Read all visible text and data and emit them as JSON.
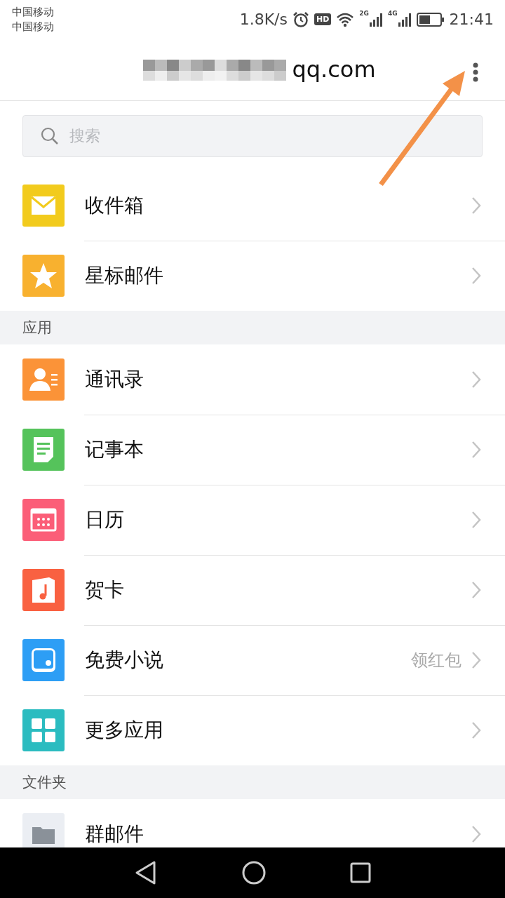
{
  "status_bar": {
    "carriers": [
      "中国移动",
      "中国移动"
    ],
    "speed": "1.8K/s",
    "hd": "HD",
    "networks": [
      "2G",
      "4G"
    ],
    "time": "21:41"
  },
  "header": {
    "title": "qq.com"
  },
  "search": {
    "placeholder": "搜索"
  },
  "sections": [
    {
      "items": [
        {
          "kind": "mail",
          "label": "收件箱",
          "color": "#f2cb1d"
        },
        {
          "kind": "star",
          "label": "星标邮件",
          "color": "#f8b12f"
        }
      ]
    },
    {
      "title": "应用",
      "items": [
        {
          "kind": "contact",
          "label": "通讯录",
          "color": "#fb9338"
        },
        {
          "kind": "note",
          "label": "记事本",
          "color": "#55c35b"
        },
        {
          "kind": "calendar",
          "label": "日历",
          "color": "#fb5e78"
        },
        {
          "kind": "card",
          "label": "贺卡",
          "color": "#f96141"
        },
        {
          "kind": "book",
          "label": "免费小说",
          "color": "#2d9ef5",
          "badge": "领红包"
        },
        {
          "kind": "apps",
          "label": "更多应用",
          "color": "#2bbcc0"
        }
      ]
    },
    {
      "title": "文件夹",
      "items": [
        {
          "kind": "folder",
          "label": "群邮件",
          "color": "#ebeef3"
        }
      ]
    }
  ]
}
